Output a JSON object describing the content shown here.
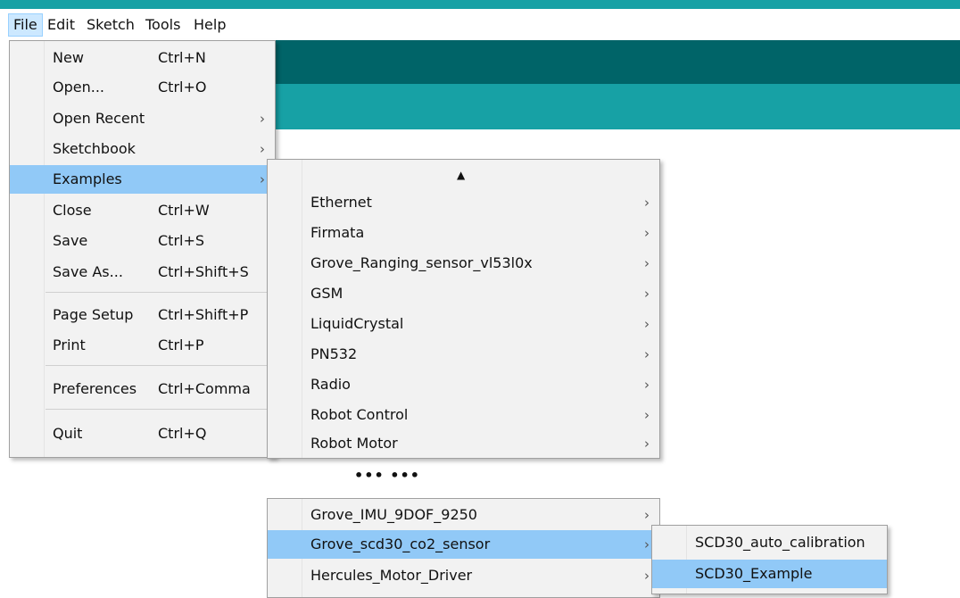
{
  "menubar": {
    "items": [
      "File",
      "Edit",
      "Sketch",
      "Tools",
      "Help"
    ]
  },
  "file_menu": {
    "items": [
      {
        "label": "New",
        "shortcut": "Ctrl+N"
      },
      {
        "label": "Open...",
        "shortcut": "Ctrl+O"
      },
      {
        "label": "Open Recent",
        "arrow": "›"
      },
      {
        "label": "Sketchbook",
        "arrow": "›"
      },
      {
        "label": "Examples",
        "arrow": "›",
        "highlighted": true
      },
      {
        "label": "Close",
        "shortcut": "Ctrl+W"
      },
      {
        "label": "Save",
        "shortcut": "Ctrl+S"
      },
      {
        "label": "Save As...",
        "shortcut": "Ctrl+Shift+S"
      },
      {
        "label": "Page Setup",
        "shortcut": "Ctrl+Shift+P"
      },
      {
        "label": "Print",
        "shortcut": "Ctrl+P"
      },
      {
        "label": "Preferences",
        "shortcut": "Ctrl+Comma"
      },
      {
        "label": "Quit",
        "shortcut": "Ctrl+Q"
      }
    ]
  },
  "examples_menu": {
    "scroll_up_glyph": "▲",
    "items": [
      {
        "label": "Ethernet",
        "arrow": "›"
      },
      {
        "label": "Firmata",
        "arrow": "›"
      },
      {
        "label": "Grove_Ranging_sensor_vl53l0x",
        "arrow": "›"
      },
      {
        "label": "GSM",
        "arrow": "›"
      },
      {
        "label": "LiquidCrystal",
        "arrow": "›"
      },
      {
        "label": "PN532",
        "arrow": "›"
      },
      {
        "label": "Radio",
        "arrow": "›"
      },
      {
        "label": "Robot Control",
        "arrow": "›"
      },
      {
        "label": "Robot Motor",
        "arrow": "›"
      }
    ]
  },
  "ellipsis": "••• •••",
  "examples_menu_lower": {
    "items": [
      {
        "label": "Grove_IMU_9DOF_9250",
        "arrow": "›"
      },
      {
        "label": "Grove_scd30_co2_sensor",
        "arrow": "›",
        "highlighted": true
      },
      {
        "label": "Hercules_Motor_Driver",
        "arrow": "›"
      }
    ]
  },
  "scd30_menu": {
    "items": [
      {
        "label": "SCD30_auto_calibration"
      },
      {
        "label": "SCD30_Example",
        "highlighted": true
      }
    ]
  },
  "colors": {
    "accent": "#17a1a5",
    "accent_dark": "#006468",
    "menu_bg": "#f2f2f2",
    "highlight": "#91c9f7"
  }
}
